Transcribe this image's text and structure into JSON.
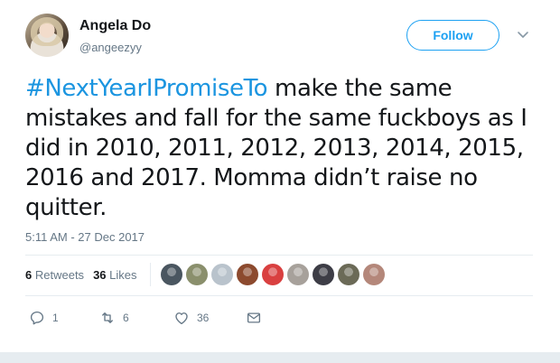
{
  "tweet": {
    "author_name": "Angela Do",
    "author_handle": "@angeezyy",
    "follow_label": "Follow",
    "hashtag": "#NextYearIPromiseTo",
    "body": " make the same mistakes and fall for the same fuckboys as I did in 2010, 2011, 2012, 2013, 2014, 2015, 2016 and 2017. Momma didn’t raise no quitter.",
    "timestamp": "5:11 AM - 27 Dec 2017"
  },
  "stats": {
    "retweets_count": "6",
    "retweets_label": "Retweets",
    "likes_count": "36",
    "likes_label": "Likes"
  },
  "likers": [
    {
      "color": "#4a5660"
    },
    {
      "color": "#8a8f6c"
    },
    {
      "color": "#b9c3cc"
    },
    {
      "color": "#8c4a2e"
    },
    {
      "color": "#d94040"
    },
    {
      "color": "#a7a19b"
    },
    {
      "color": "#3d3d46"
    },
    {
      "color": "#6b6a57"
    },
    {
      "color": "#b4877a"
    }
  ],
  "actions": {
    "reply_count": "1",
    "retweet_count": "6",
    "like_count": "36"
  },
  "colors": {
    "accent": "#1da1f2",
    "hashtag": "#1b95e0",
    "muted": "#657786"
  }
}
